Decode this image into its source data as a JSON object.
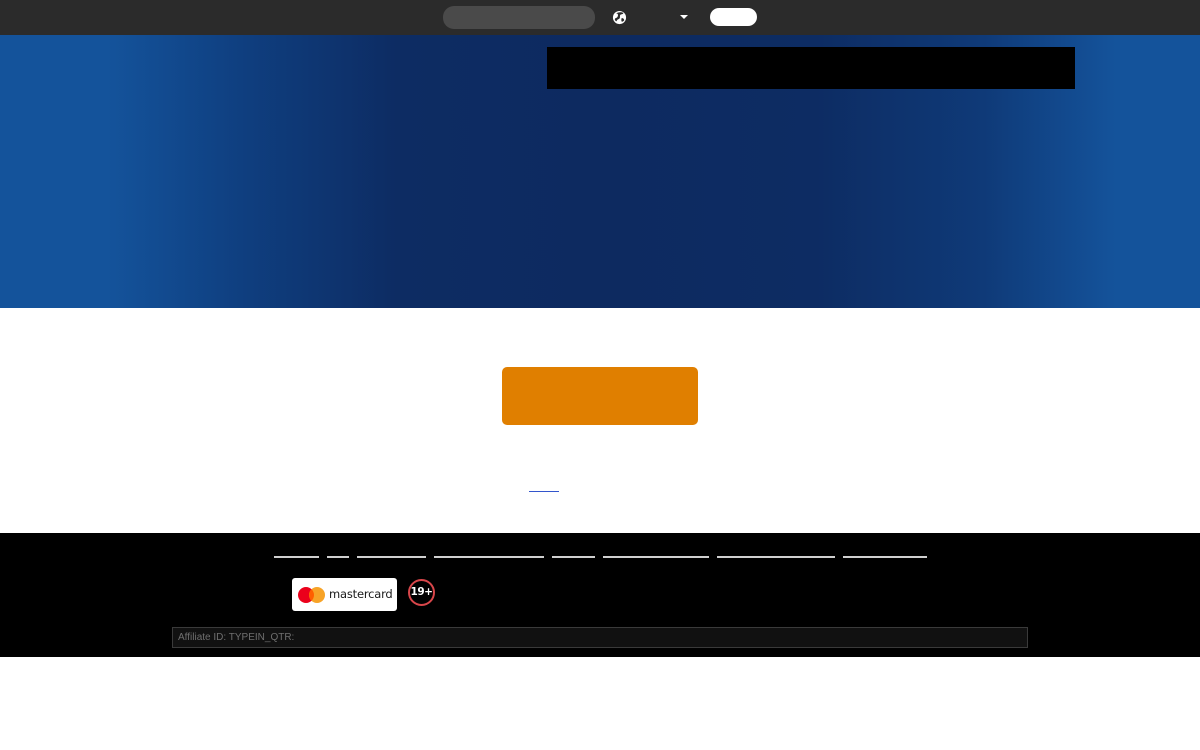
{
  "topbar": {
    "search": {
      "value": "",
      "placeholder": ""
    },
    "language": {
      "label": "",
      "globe_icon": "globe-icon",
      "caret_icon": "chevron-down-icon"
    },
    "account_button_label": ""
  },
  "hero": {
    "banner_text": "",
    "gradient_colors": [
      "#14539b",
      "#0d2a60",
      "#14539b"
    ]
  },
  "main": {
    "cta_label": "",
    "cta_color": "#e07f00",
    "link_text": ""
  },
  "footer": {
    "links": [
      {
        "label": ""
      },
      {
        "label": ""
      },
      {
        "label": ""
      },
      {
        "label": ""
      },
      {
        "label": ""
      },
      {
        "label": ""
      },
      {
        "label": ""
      },
      {
        "label": ""
      }
    ],
    "payment_logo": {
      "label": "mastercard",
      "icon": "mastercard-logo",
      "colors": [
        "#eb001b",
        "#f79e1b"
      ]
    },
    "age_badge": {
      "label": "19+",
      "color": "#d8464a"
    },
    "affiliate_text": "Affiliate ID: TYPEIN_QTR:"
  }
}
